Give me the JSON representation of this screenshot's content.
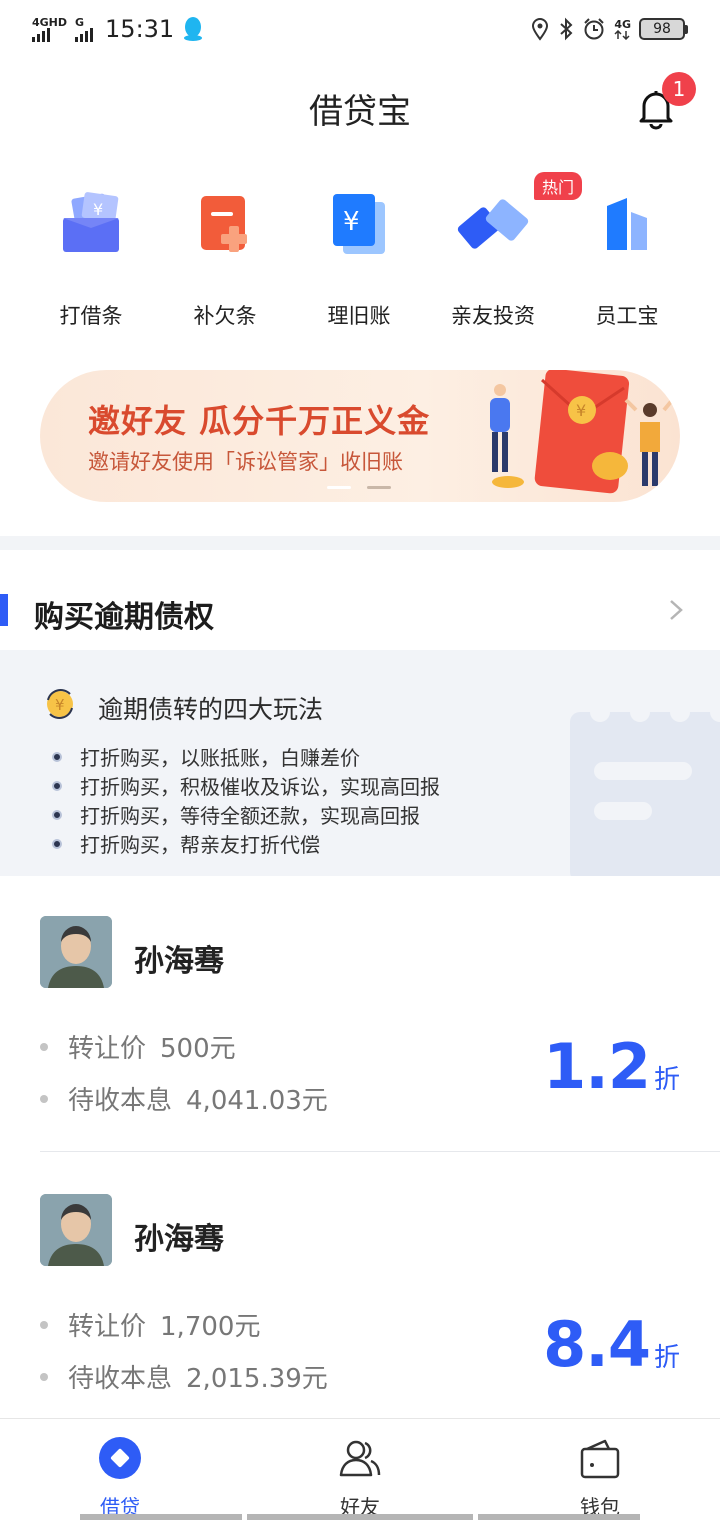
{
  "status_bar": {
    "net1": "4GHD",
    "net2": "G",
    "time": "15:31",
    "net3": "4G",
    "battery": "98"
  },
  "header": {
    "title": "借贷宝",
    "notification_count": "1"
  },
  "quick_actions": [
    {
      "label": "打借条",
      "icon": "iou-wallet-icon"
    },
    {
      "label": "补欠条",
      "icon": "supplement-note-icon"
    },
    {
      "label": "理旧账",
      "icon": "old-accounts-icon"
    },
    {
      "label": "亲友投资",
      "icon": "handshake-icon",
      "badge": "热门"
    },
    {
      "label": "员工宝",
      "icon": "employee-chart-icon"
    }
  ],
  "banner": {
    "title": "邀好友 瓜分千万正义金",
    "subtitle": "邀请好友使用「诉讼管家」收旧账",
    "slide_count": 2,
    "active_slide": 1
  },
  "section": {
    "title": "购买逾期债权",
    "info_title": "逾期债转的四大玩法",
    "info_items": [
      "打折购买，以账抵账，白赚差价",
      "打折购买，积极催收及诉讼，实现高回报",
      "打折购买，等待全额还款，实现高回报",
      "打折购买，帮亲友打折代偿"
    ]
  },
  "debts": [
    {
      "name": "孙海骞",
      "price_label": "转让价",
      "price": "500元",
      "receivable_label": "待收本息",
      "receivable": "4,041.03元",
      "discount": "1.2",
      "discount_unit": "折"
    },
    {
      "name": "孙海骞",
      "price_label": "转让价",
      "price": "1,700元",
      "receivable_label": "待收本息",
      "receivable": "2,015.39元",
      "discount": "8.4",
      "discount_unit": "折"
    }
  ],
  "bottom_nav": [
    {
      "label": "借贷",
      "icon": "lending-icon",
      "active": true
    },
    {
      "label": "好友",
      "icon": "friends-icon",
      "active": false
    },
    {
      "label": "钱包",
      "icon": "wallet-icon",
      "active": false
    }
  ],
  "colors": {
    "accent": "#2e5cf6",
    "badge": "#f0414b",
    "banner_text": "#d94a2e"
  }
}
